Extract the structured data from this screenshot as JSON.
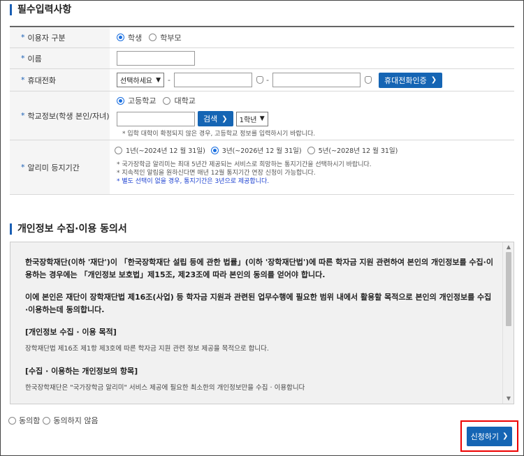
{
  "section1": {
    "title": "필수입력사항",
    "rows": {
      "user_type": {
        "label": "이용자 구분",
        "options": [
          "학생",
          "학부모"
        ],
        "selected": "학생"
      },
      "name": {
        "label": "이름",
        "value": ""
      },
      "phone": {
        "label": "휴대전화",
        "select_value": "선택하세요",
        "dash": "-",
        "verify_button": "휴대전화인증"
      },
      "school": {
        "label": "학교정보(학생 본인/자녀)",
        "options": [
          "고등학교",
          "대학교"
        ],
        "selected": "고등학교",
        "search_button": "검색",
        "grade_value": "1학년",
        "note": "* 입학 대학이 확정되지 않은 경우, 고등학교 정보를 입력하시기 바랍니다."
      },
      "period": {
        "label": "알리미 등지기간",
        "options": [
          "1년(~2024년 12 월 31일)",
          "3년(~2026년 12 월 31일)",
          "5년(~2028년 12 월 31일)"
        ],
        "selected": "3년(~2026년 12 월 31일)",
        "notes": [
          "* 국가장학금 알리미는 최대 5년간 제공되는 서비스로 희망하는 통지기간을 선택하시기 바랍니다.",
          "* 지속적인 알림을 원하신다면 매년 12월 통지기간 연장 신청이 가능합니다."
        ],
        "note_blue": "* 별도 선택이 없을 경우, 통지기간은 3년으로 제공합니다."
      }
    }
  },
  "section2": {
    "title": "개인정보 수집·이용 동의서",
    "para1": "한국장학재단(이하 '재단')이 「한국장학재단 설립 등에 관한 법률」(이하 '장학재단법')에 따른 학자금 지원 관련하여 본인의 개인정보를 수집·이용하는 경우에는 「개인정보 보호법」제15조, 제23조에 따라 본인의 동의를 얻어야 합니다.",
    "para2": "이에 본인은 재단이 장학재단법 제16조(사업) 등 학자금 지원과 관련된 업무수행에 필요한 범위 내에서 활용할 목적으로 본인의 개인정보를 수집·이용하는데 동의합니다.",
    "head1": "[개인정보 수집 · 이용 목적]",
    "text1": "장학재단법 제16조 제1항 제3호에 따른 학자금 지원 관련 정보 제공을 목적으로 합니다.",
    "head2": "[수집 · 이용하는 개인정보의 항목]",
    "text2": "한국장학재단은 \"국가장학금 알리미\" 서비스 제공에 필요한 최소한의 개인정보만을 수집 · 이용합니다"
  },
  "agree": {
    "options": [
      "동의함",
      "동의하지 않음"
    ]
  },
  "submit_label": "신청하기",
  "colors": {
    "accent": "#1565b4",
    "highlight": "#ee0000"
  }
}
